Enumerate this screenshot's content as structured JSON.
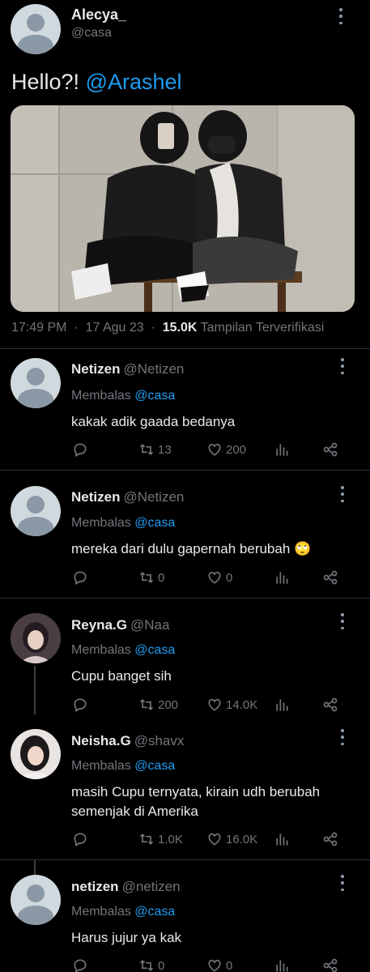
{
  "tweet": {
    "author_name": "Alecya_",
    "author_handle": "@casa",
    "text_prefix": "Hello?!",
    "mention": "@Arashel",
    "time": "17:49 PM",
    "date": "17 Agu 23",
    "views_count": "15.0K",
    "views_label": "Tampilan",
    "verified_label": "Terverifikasi"
  },
  "replies": [
    {
      "name": "Netizen",
      "handle": "@Netizen",
      "replying_label": "Membalas",
      "replying_to": "@casa",
      "text": "kakak adik gaada bedanya",
      "retweets": "13",
      "likes": "200"
    },
    {
      "name": "Netizen",
      "handle": "@Netizen",
      "replying_label": "Membalas",
      "replying_to": "@casa",
      "text": "mereka dari dulu gapernah berubah 🙄",
      "retweets": "0",
      "likes": "0"
    },
    {
      "name": "Reyna.G",
      "handle": "@Naa",
      "replying_label": "Membalas",
      "replying_to": "@casa",
      "text": "Cupu banget sih",
      "retweets": "200",
      "likes": "14.0K"
    },
    {
      "name": "Neisha.G",
      "handle": "@shavx",
      "replying_label": "Membalas",
      "replying_to": "@casa",
      "text_line1": "masih Cupu ternyata, kirain udh berubah",
      "text_line2": "semenjak di Amerika",
      "retweets": "1.0K",
      "likes": "16.0K"
    },
    {
      "name": "netizen",
      "handle": "@netizen",
      "replying_label": "Membalas",
      "replying_to": "@casa",
      "text": "Harus jujur ya kak",
      "retweets": "0",
      "likes": "0"
    }
  ],
  "colors": {
    "background": "#000000",
    "text_primary": "#e7e9ea",
    "text_secondary": "#71767b",
    "link": "#1d9bf0",
    "divider": "#2f3336"
  },
  "icons": [
    "reply-icon",
    "retweet-icon",
    "like-icon",
    "views-icon",
    "share-icon",
    "more-icon"
  ]
}
